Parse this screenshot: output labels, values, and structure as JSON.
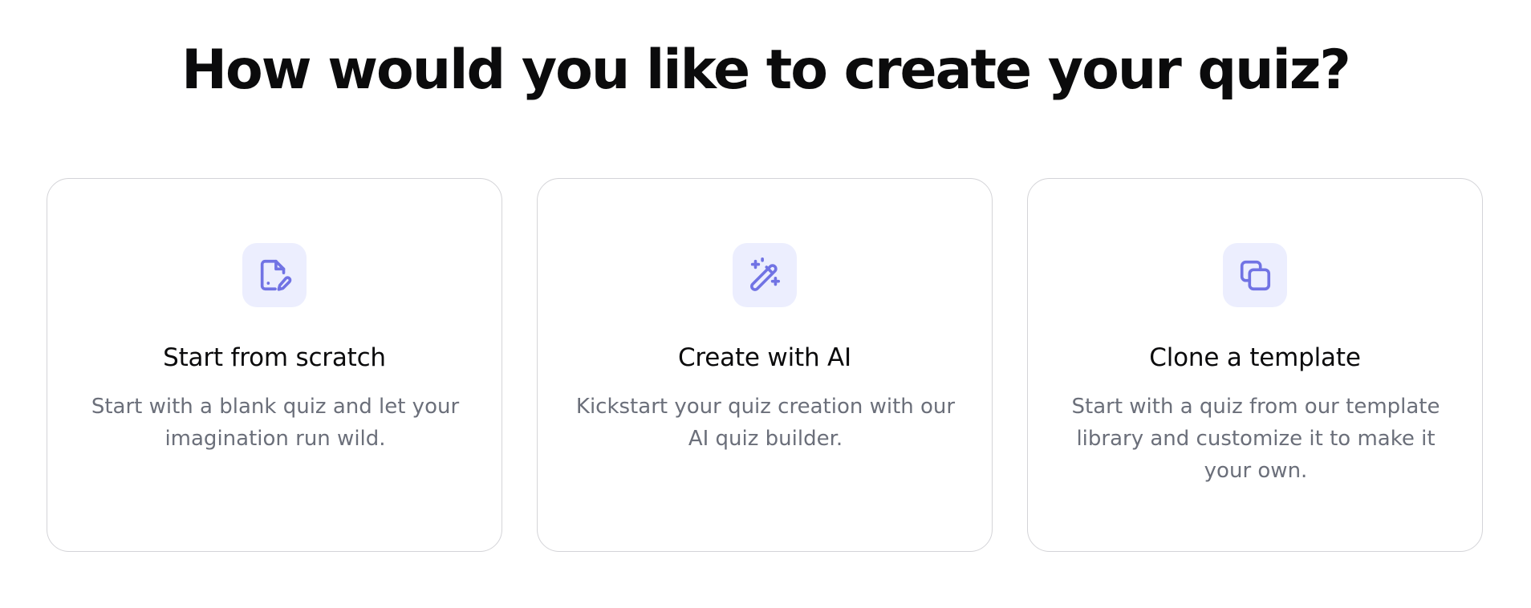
{
  "page": {
    "title": "How would you like to create your quiz?"
  },
  "colors": {
    "accent": "#7173e4",
    "icon_bg": "#eceefe",
    "card_border": "#d4d4d8",
    "title_text": "#0b0b0c",
    "desc_text": "#6b6f7a"
  },
  "options": [
    {
      "icon": "document-edit-icon",
      "title": "Start from scratch",
      "description": "Start with a blank quiz and let your imagination run wild."
    },
    {
      "icon": "magic-wand-icon",
      "title": "Create with AI",
      "description": "Kickstart your quiz creation with our AI quiz builder."
    },
    {
      "icon": "copy-icon",
      "title": "Clone a template",
      "description": "Start with a quiz from our template library and customize it to make it your own."
    }
  ]
}
